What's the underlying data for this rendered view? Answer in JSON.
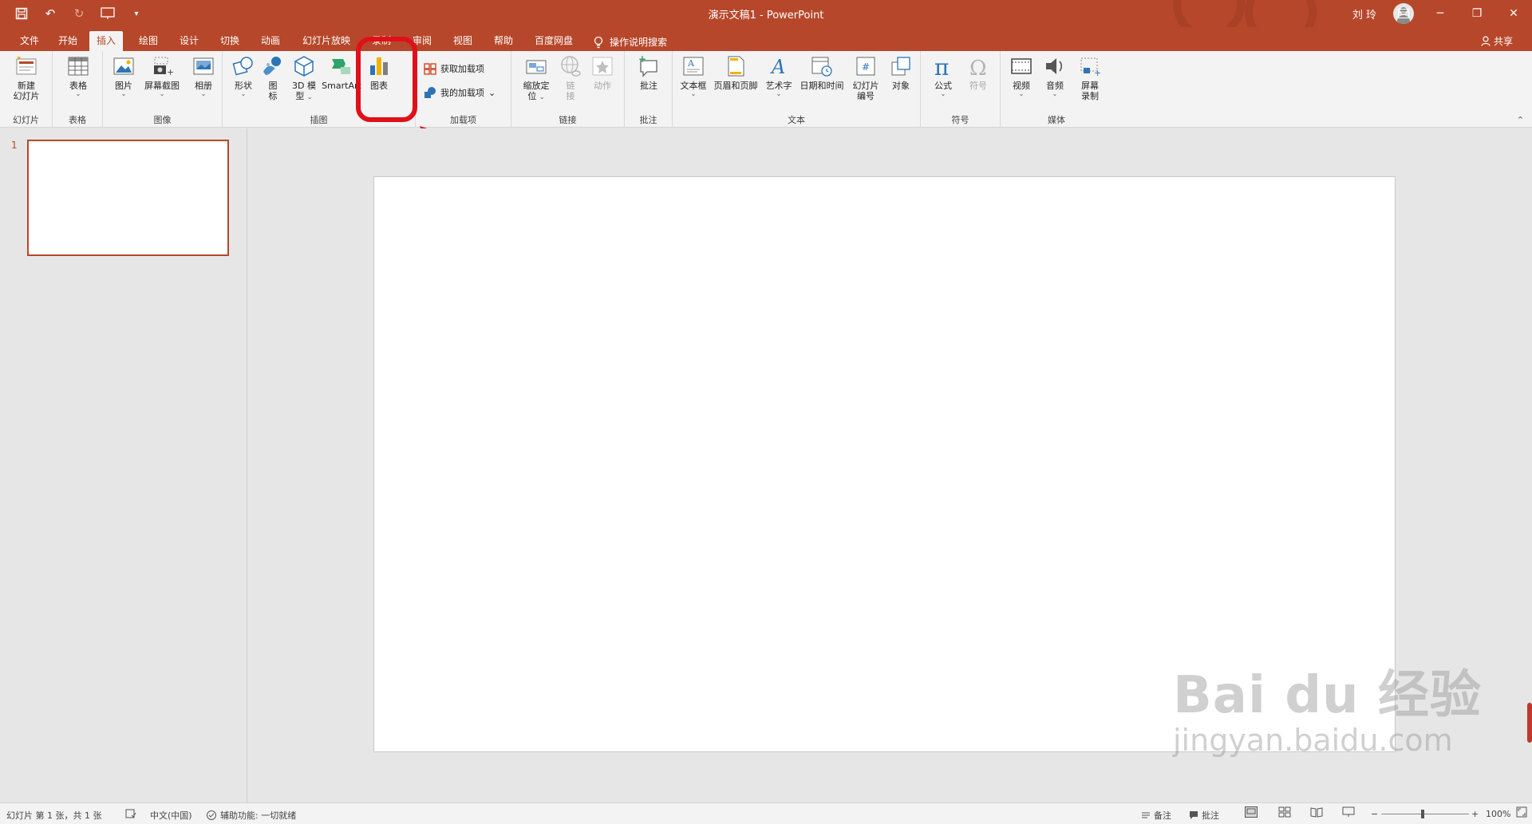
{
  "colors": {
    "accent": "#b7472a",
    "ribbon_bg": "#f3f3f3",
    "highlight": "#e0101a"
  },
  "titlebar": {
    "doc_title": "演示文稿1 - PowerPoint",
    "user_name": "刘 玲"
  },
  "tabs": [
    "文件",
    "开始",
    "插入",
    "绘图",
    "设计",
    "切换",
    "动画",
    "幻灯片放映",
    "录制",
    "审阅",
    "视图",
    "帮助",
    "百度网盘"
  ],
  "active_tab": "插入",
  "tell_me": "操作说明搜索",
  "share": "共享",
  "ribbon": {
    "slides": {
      "label": "幻灯片",
      "new_slide_1": "新建",
      "new_slide_2": "幻灯片"
    },
    "tables": {
      "label": "表格",
      "table": "表格"
    },
    "images": {
      "label": "图像",
      "picture": "图片",
      "screenshot": "屏幕截图",
      "album": "相册"
    },
    "illustrations": {
      "label": "插图",
      "shapes": "形状",
      "icons_1": "图",
      "icons_2": "标",
      "model_1": "3D 模",
      "model_2": "型",
      "smartart": "SmartArt",
      "chart": "图表"
    },
    "addins": {
      "label": "加载项",
      "get": "获取加载项",
      "mine": "我的加载项"
    },
    "links": {
      "label": "链接",
      "zoom_1": "缩放定",
      "zoom_2": "位",
      "link_1": "链",
      "link_2": "接",
      "action": "动作"
    },
    "comments": {
      "label": "批注",
      "comment": "批注"
    },
    "text": {
      "label": "文本",
      "textbox": "文本框",
      "header_footer": "页眉和页脚",
      "wordart": "艺术字",
      "datetime": "日期和时间",
      "slide_num_1": "幻灯片",
      "slide_num_2": "编号",
      "object": "对象"
    },
    "symbols": {
      "label": "符号",
      "equation": "公式",
      "symbol": "符号"
    },
    "media": {
      "label": "媒体",
      "video": "视频",
      "audio": "音频",
      "record_1": "屏幕",
      "record_2": "录制"
    }
  },
  "thumbnails": [
    {
      "number": "1"
    }
  ],
  "statusbar": {
    "slide_info": "幻灯片 第 1 张，共 1 张",
    "language": "中文(中国)",
    "accessibility": "辅助功能: 一切就绪",
    "notes": "备注",
    "comments": "批注",
    "zoom": "100%"
  },
  "watermark": {
    "main": "Bai du 经验",
    "sub": "jingyan.baidu.com"
  }
}
